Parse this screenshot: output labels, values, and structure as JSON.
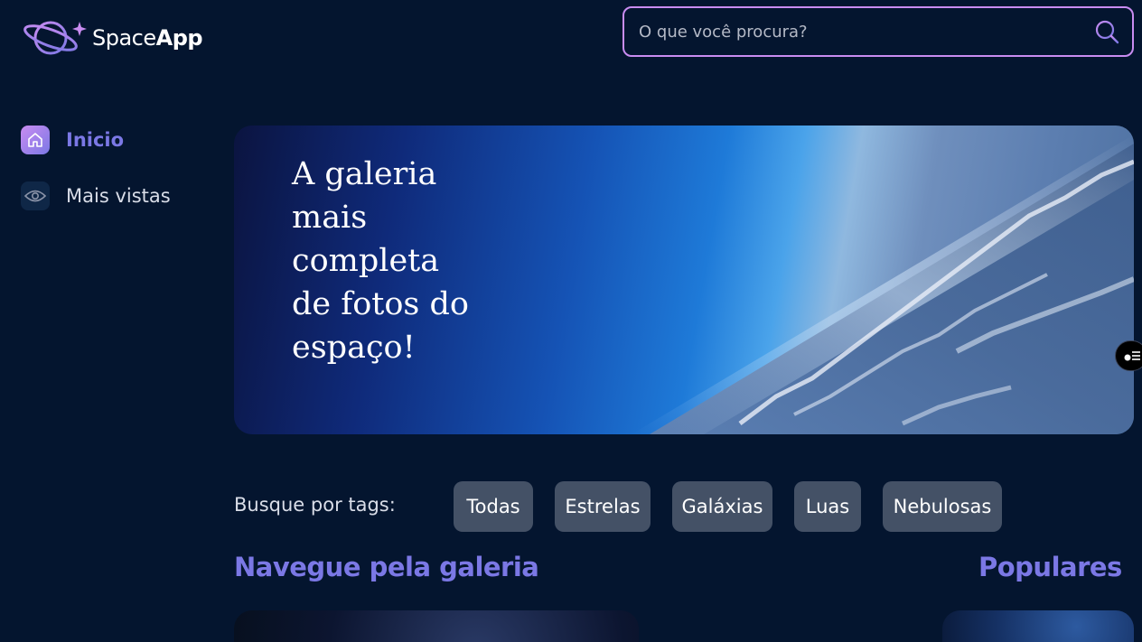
{
  "header": {
    "logo": {
      "text_light": "Space",
      "text_bold": "App",
      "icon": "planet-logo-icon"
    },
    "search": {
      "placeholder": "O que você procura?",
      "value": "",
      "icon": "search-icon"
    }
  },
  "sidebar": {
    "items": [
      {
        "label": "Inicio",
        "icon": "home-icon",
        "active": true
      },
      {
        "label": "Mais vistas",
        "icon": "eye-icon",
        "active": false
      }
    ]
  },
  "banner": {
    "title": "A galeria mais completa de fotos do espaço!"
  },
  "tags": {
    "label": "Busque por tags:",
    "items": [
      "Todas",
      "Estrelas",
      "Galáxias",
      "Luas",
      "Nebulosas"
    ]
  },
  "sections": {
    "gallery_title": "Navegue pela galeria",
    "popular_title": "Populares"
  },
  "colors": {
    "background": "#04152f",
    "accent": "#7b78e5",
    "accent_light": "#c98cf1",
    "tag_bg": "rgba(217,221,232,0.3)"
  }
}
